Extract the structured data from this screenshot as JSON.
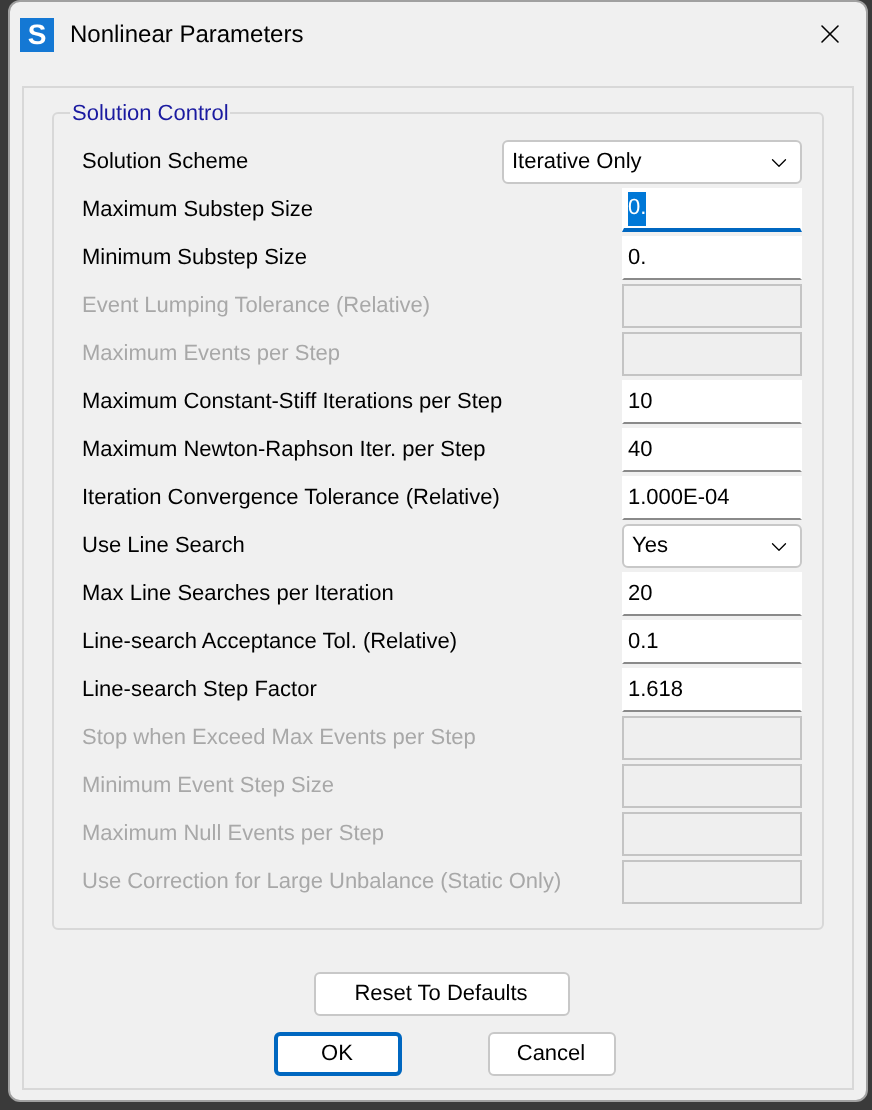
{
  "window": {
    "title": "Nonlinear Parameters",
    "app_icon": "S"
  },
  "group": {
    "title": "Solution Control"
  },
  "rows": [
    {
      "label": "Solution Scheme",
      "kind": "select",
      "value": "Iterative Only",
      "disabled": false,
      "wide": true
    },
    {
      "label": "Maximum Substep Size",
      "kind": "text",
      "value": "0.",
      "disabled": false,
      "focused": true
    },
    {
      "label": "Minimum Substep Size",
      "kind": "text",
      "value": "0.",
      "disabled": false,
      "focused": false
    },
    {
      "label": "Event Lumping Tolerance (Relative)",
      "kind": "text",
      "disabled": true,
      "focused": false
    },
    {
      "label": "Maximum Events per Step",
      "kind": "text",
      "disabled": true,
      "focused": false
    },
    {
      "label": "Maximum Constant-Stiff Iterations per Step",
      "kind": "text",
      "value": "10",
      "disabled": false,
      "focused": false
    },
    {
      "label": "Maximum Newton-Raphson Iter. per Step",
      "kind": "text",
      "value": "40",
      "disabled": false,
      "focused": false
    },
    {
      "label": "Iteration Convergence Tolerance (Relative)",
      "kind": "text",
      "value": "1.000E-04",
      "disabled": false,
      "focused": false
    },
    {
      "label": "Use Line Search",
      "kind": "select",
      "value": "Yes",
      "disabled": false,
      "wide": false
    },
    {
      "label": "Max Line Searches per Iteration",
      "kind": "text",
      "value": "20",
      "disabled": false,
      "focused": false
    },
    {
      "label": "Line-search Acceptance Tol. (Relative)",
      "kind": "text",
      "value": "0.1",
      "disabled": false,
      "focused": false
    },
    {
      "label": "Line-search Step Factor",
      "kind": "text",
      "value": "1.618",
      "disabled": false,
      "focused": false
    },
    {
      "label": "Stop when Exceed Max Events per Step",
      "kind": "text",
      "disabled": true,
      "focused": false
    },
    {
      "label": "Minimum Event Step Size",
      "kind": "text",
      "disabled": true,
      "focused": false
    },
    {
      "label": "Maximum Null Events per Step",
      "kind": "text",
      "disabled": true,
      "focused": false
    },
    {
      "label": "Use Correction for Large Unbalance (Static Only)",
      "kind": "text",
      "disabled": true,
      "focused": false
    }
  ],
  "buttons": {
    "reset": "Reset To Defaults",
    "ok": "OK",
    "cancel": "Cancel"
  }
}
